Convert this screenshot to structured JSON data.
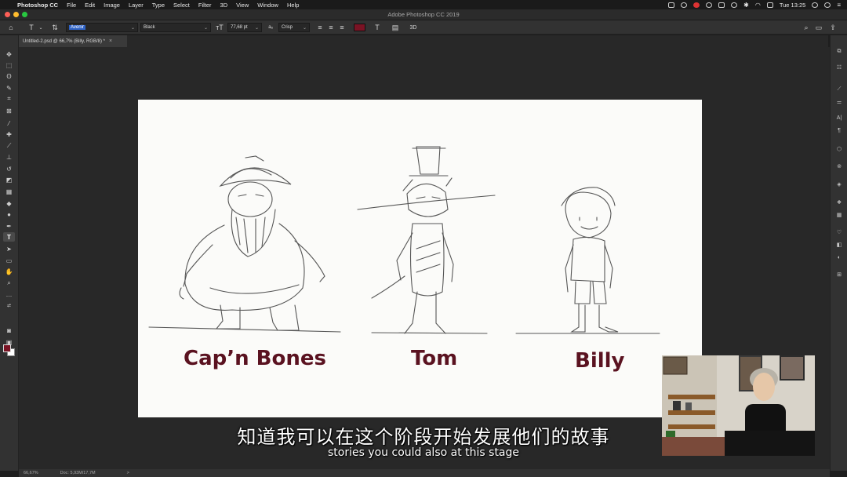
{
  "menubar": {
    "apple_glyph": "",
    "items": [
      "Photoshop CC",
      "File",
      "Edit",
      "Image",
      "Layer",
      "Type",
      "Select",
      "Filter",
      "3D",
      "View",
      "Window",
      "Help"
    ],
    "clock": "Tue 13:25"
  },
  "window": {
    "title": "Adobe Photoshop CC 2019"
  },
  "options": {
    "font_family": "Avenir",
    "font_style": "Black",
    "font_size": "77,68 pt",
    "aa_label": "aₐ",
    "antialias": "Crisp",
    "text_color": "#7a1324"
  },
  "document": {
    "tab_label": "Untitled-2.psd @ 66,7% (Billy, RGB/8) *"
  },
  "canvas": {
    "characters": [
      {
        "name": "Cap’n Bones"
      },
      {
        "name": "Tom"
      },
      {
        "name": "Billy"
      }
    ],
    "name_color": "#5a1220"
  },
  "statusbar": {
    "zoom": "66,67%",
    "doc_info": "Doc: 5,93M/17,7M",
    "arrow": ">"
  },
  "subtitles": {
    "zh": "知道我可以在这个阶段开始发展他们的故事",
    "en": "stories you could also at this stage"
  },
  "colors": {
    "foreground": "#7a1324",
    "background": "#ffffff",
    "ui_panel": "#323232",
    "workspace": "#282828"
  }
}
